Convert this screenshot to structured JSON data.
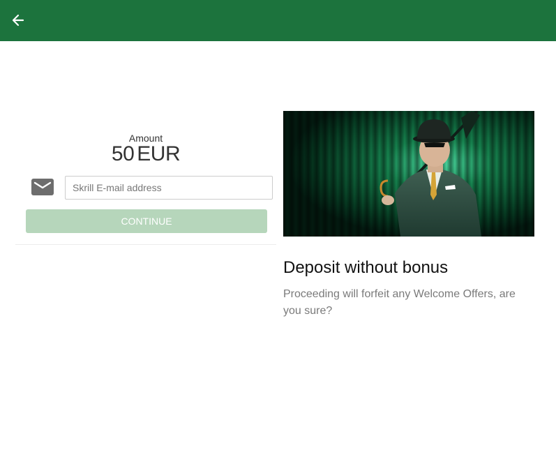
{
  "header": {
    "back_icon": "arrow-left-icon",
    "bar_color": "#1c733d"
  },
  "deposit_form": {
    "amount_label": "Amount",
    "amount_value": "50",
    "currency": "EUR",
    "email_icon": "envelope-icon",
    "email_placeholder": "Skrill E-mail address",
    "email_value": "",
    "continue_label": "CONTINUE",
    "continue_color": "#b6d6bb"
  },
  "offer": {
    "image": "mr-green-character-with-umbrella",
    "title": "Deposit without bonus",
    "message": "Proceeding will forfeit any Welcome Offers, are you sure?"
  }
}
